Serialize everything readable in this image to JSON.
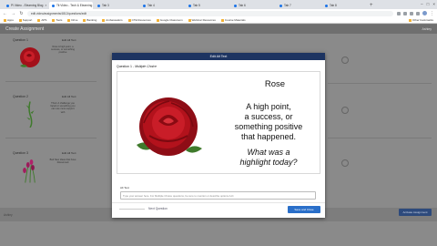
{
  "browser": {
    "tabs": [
      {
        "label": "Pi Video - Elearning Blog"
      },
      {
        "label": "Tit Video - Tech & Elearning"
      },
      {
        "label": "Tab 3"
      },
      {
        "label": "Tab 4"
      },
      {
        "label": "Tab 5"
      },
      {
        "label": "Tab 6"
      },
      {
        "label": "Tab 7"
      },
      {
        "label": "Tab 8"
      }
    ],
    "url": "edit.video/assignments/4812/questions/edit"
  },
  "bookmarks": [
    {
      "label": "Apps"
    },
    {
      "label": "Support"
    },
    {
      "label": "APS"
    },
    {
      "label": "Tools"
    },
    {
      "label": "Drive"
    },
    {
      "label": "Banking"
    },
    {
      "label": "Ambassadors"
    },
    {
      "label": "CTE Resources"
    },
    {
      "label": "Google Classroom"
    },
    {
      "label": "Webinar Resources"
    },
    {
      "label": "Course Materials"
    }
  ],
  "bookmarks_other": "Other bookmarks",
  "page": {
    "title": "Create Assignment",
    "user": "Ashley",
    "questions": [
      {
        "label": "Question 1",
        "edit": "Edit All Text",
        "text": "Rose A high point, a success, or something positive"
      },
      {
        "label": "Question 2",
        "edit": "Edit All Text",
        "text": "Thorn A challenge you faced or something you can use more support with"
      },
      {
        "label": "Question 3",
        "edit": "Edit All Text",
        "text": "Bud New ideas that have blossomed"
      }
    ],
    "activate_label": "Activate Assignment"
  },
  "modal": {
    "header": "Edit Alt Text",
    "question_label": "Question 1 -",
    "question_type": "Multiple Choice",
    "slide": {
      "title": "Rose",
      "body_lines": [
        "A high point,",
        "a success, or",
        "something positive",
        "that happened."
      ],
      "question_lines": [
        "What was a",
        "highlight today?"
      ]
    },
    "alt_text_label": "Alt Text",
    "alt_text_placeholder": "Type your answer here. For Multiple Choice questions, be sure to mention or describe options A-D.",
    "next_label": "Next Question",
    "save_label": "Save and Close"
  },
  "colors": {
    "modal_header": "#1d3461",
    "save_button": "#2a6fc9",
    "rose": "#b3121c"
  }
}
